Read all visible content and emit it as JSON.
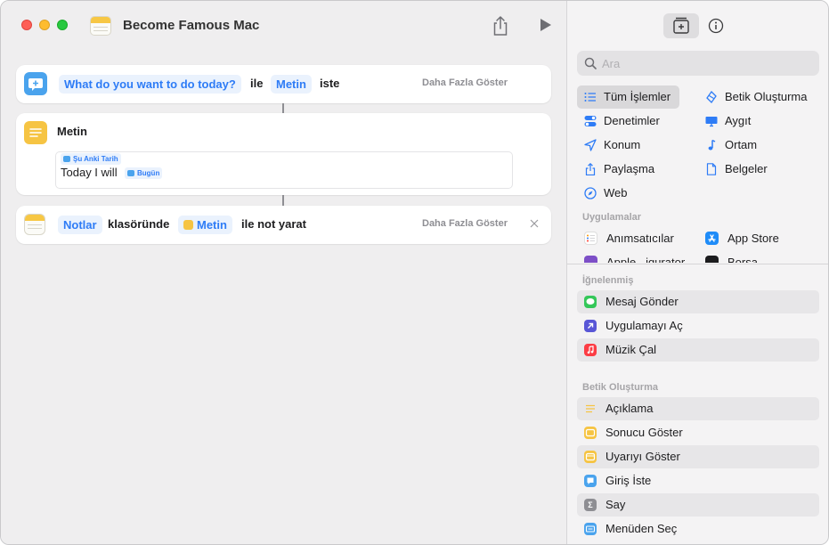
{
  "window": {
    "title": "Become Famous Mac"
  },
  "editor": {
    "action1": {
      "prompt_token": "What do you want to do today?",
      "connector_word": "ile",
      "type_token": "Metin",
      "verb": "iste",
      "more_label": "Daha Fazla Göster"
    },
    "action2": {
      "heading": "Metin",
      "date_token": "Şu Anki Tarih",
      "text_prefix": "Today I will",
      "inline_token": "Bugün"
    },
    "action3": {
      "folder_token": "Notlar",
      "folder_suffix": "klasöründe",
      "content_token": "Metin",
      "verb": "ile not yarat",
      "more_label": "Daha Fazla Göster"
    }
  },
  "sidebar": {
    "search_placeholder": "Ara",
    "categories_left": [
      {
        "label": "Tüm İşlemler",
        "icon": "list-icon",
        "selected": true
      },
      {
        "label": "Denetimler",
        "icon": "toggle-icon"
      },
      {
        "label": "Konum",
        "icon": "location-arrow-icon"
      },
      {
        "label": "Paylaşma",
        "icon": "share-icon"
      },
      {
        "label": "Web",
        "icon": "compass-icon"
      }
    ],
    "categories_right": [
      {
        "label": "Betik Oluşturma",
        "icon": "scripting-icon"
      },
      {
        "label": "Aygıt",
        "icon": "display-icon"
      },
      {
        "label": "Ortam",
        "icon": "music-note-icon"
      },
      {
        "label": "Belgeler",
        "icon": "document-icon"
      }
    ],
    "apps_label": "Uygulamalar",
    "apps": [
      {
        "label": "Anımsatıcılar",
        "icon": "reminders-icon"
      },
      {
        "label": "App Store",
        "icon": "app-store-icon"
      },
      {
        "label": "Apple...igurator",
        "icon": "configurator-icon"
      },
      {
        "label": "Borsa",
        "icon": "stocks-icon"
      }
    ],
    "pinned_label": "İğnelenmiş",
    "pinned": [
      {
        "label": "Mesaj Gönder",
        "icon": "messages-icon",
        "color": "#34c759"
      },
      {
        "label": "Uygulamayı Aç",
        "icon": "open-app-icon",
        "color": "#5856d6"
      },
      {
        "label": "Müzik Çal",
        "icon": "music-icon",
        "color": "#fc3c44"
      }
    ],
    "scripting_label": "Betik Oluşturma",
    "scripting": [
      {
        "label": "Açıklama",
        "icon": "comment-icon",
        "color": "#f6c443"
      },
      {
        "label": "Sonucu Göster",
        "icon": "show-result-icon",
        "color": "#f6c443"
      },
      {
        "label": "Uyarıyı Göster",
        "icon": "alert-icon",
        "color": "#f6c443"
      },
      {
        "label": "Giriş İste",
        "icon": "ask-input-icon",
        "color": "#4aa3ed"
      },
      {
        "label": "Say",
        "icon": "count-icon",
        "color": "#8e8e93"
      },
      {
        "label": "Menüden Seç",
        "icon": "menu-icon",
        "color": "#4aa3ed"
      }
    ]
  }
}
